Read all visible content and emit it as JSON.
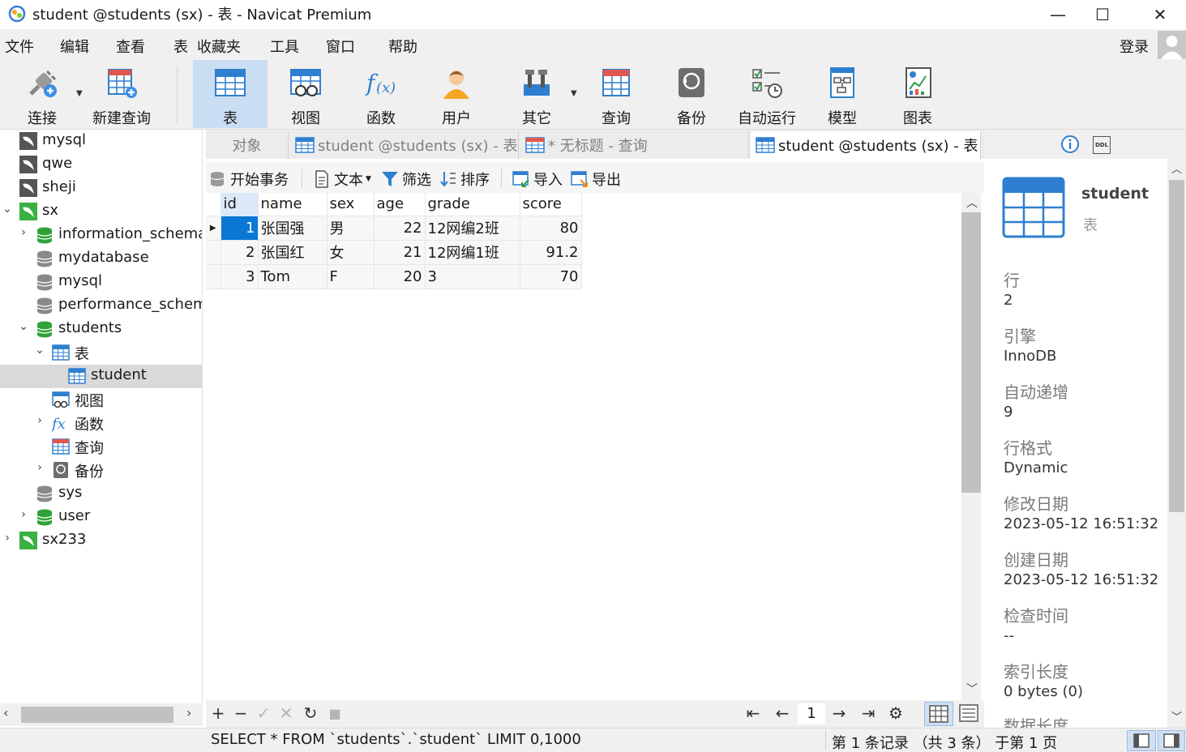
{
  "window": {
    "title": "student @students (sx) - 表 - Navicat Premium",
    "minimize": "—",
    "maximize": "☐",
    "close": "✕"
  },
  "menu": {
    "items": [
      "文件",
      "编辑",
      "查看",
      "表",
      "收藏夹",
      "工具",
      "窗口",
      "帮助"
    ],
    "login": "登录"
  },
  "toolbar": {
    "items": [
      {
        "label": "连接",
        "icon": "plug-icon"
      },
      {
        "label": "新建查询",
        "icon": "new-query-icon"
      },
      {
        "label": "表",
        "icon": "table-icon",
        "active": true
      },
      {
        "label": "视图",
        "icon": "view-icon"
      },
      {
        "label": "函数",
        "icon": "function-icon"
      },
      {
        "label": "用户",
        "icon": "user-icon"
      },
      {
        "label": "其它",
        "icon": "tools-icon"
      },
      {
        "label": "查询",
        "icon": "query-icon"
      },
      {
        "label": "备份",
        "icon": "backup-icon"
      },
      {
        "label": "自动运行",
        "icon": "schedule-icon"
      },
      {
        "label": "模型",
        "icon": "model-icon"
      },
      {
        "label": "图表",
        "icon": "chart-icon"
      }
    ]
  },
  "tree": {
    "nodes": [
      {
        "label": "mysql",
        "level": 0,
        "type": "connection"
      },
      {
        "label": "qwe",
        "level": 0,
        "type": "connection"
      },
      {
        "label": "sheji",
        "level": 0,
        "type": "connection"
      },
      {
        "label": "sx",
        "level": 0,
        "type": "connection-open"
      },
      {
        "label": "information_schema",
        "level": 1,
        "type": "database-open"
      },
      {
        "label": "mydatabase",
        "level": 1,
        "type": "database"
      },
      {
        "label": "mysql",
        "level": 1,
        "type": "database"
      },
      {
        "label": "performance_schema",
        "level": 1,
        "type": "database"
      },
      {
        "label": "students",
        "level": 1,
        "type": "database-open"
      },
      {
        "label": "表",
        "level": 2,
        "type": "tables"
      },
      {
        "label": "student",
        "level": 3,
        "type": "table"
      },
      {
        "label": "视图",
        "level": 2,
        "type": "views"
      },
      {
        "label": "函数",
        "level": 2,
        "type": "functions"
      },
      {
        "label": "查询",
        "level": 2,
        "type": "queries"
      },
      {
        "label": "备份",
        "level": 2,
        "type": "backups"
      },
      {
        "label": "sys",
        "level": 1,
        "type": "database"
      },
      {
        "label": "user",
        "level": 1,
        "type": "database-open"
      },
      {
        "label": "sx233",
        "level": 0,
        "type": "connection-open"
      }
    ]
  },
  "tabs": [
    {
      "label": "对象"
    },
    {
      "label": "student @students (sx) - 表"
    },
    {
      "label": "* 无标题 - 查询"
    },
    {
      "label": "student @students (sx) - 表"
    }
  ],
  "datatoolbar": {
    "begin_tx": "开始事务",
    "text": "文本",
    "filter": "筛选",
    "sort": "排序",
    "import": "导入",
    "export": "导出"
  },
  "grid": {
    "columns": [
      "id",
      "name",
      "sex",
      "age",
      "grade",
      "score"
    ],
    "rows": [
      [
        "1",
        "张国强",
        "男",
        "22",
        "12网编2班",
        "80"
      ],
      [
        "2",
        "张国红",
        "女",
        "21",
        "12网编1班",
        "91.2"
      ],
      [
        "3",
        "Tom",
        "F",
        "20",
        "3",
        "70"
      ]
    ]
  },
  "bottombar": {
    "add": "+",
    "remove": "−",
    "apply": "✓",
    "discard": "✕",
    "refresh": "↻",
    "stop": "■",
    "page": "1"
  },
  "status": {
    "sql": "SELECT * FROM `students`.`student` LIMIT 0,1000",
    "records": "第 1 条记录 （共 3 条） 于第 1 页"
  },
  "info": {
    "name": "student",
    "type": "表",
    "fields": [
      {
        "label": "行",
        "value": "2"
      },
      {
        "label": "引擎",
        "value": "InnoDB"
      },
      {
        "label": "自动递增",
        "value": "9"
      },
      {
        "label": "行格式",
        "value": "Dynamic"
      },
      {
        "label": "修改日期",
        "value": "2023-05-12 16:51:32"
      },
      {
        "label": "创建日期",
        "value": "2023-05-12 16:51:32"
      },
      {
        "label": "检查时间",
        "value": "--"
      },
      {
        "label": "索引长度",
        "value": "0 bytes (0)"
      },
      {
        "label": "数据长度",
        "value": ""
      }
    ],
    "ddl": "DDL"
  }
}
